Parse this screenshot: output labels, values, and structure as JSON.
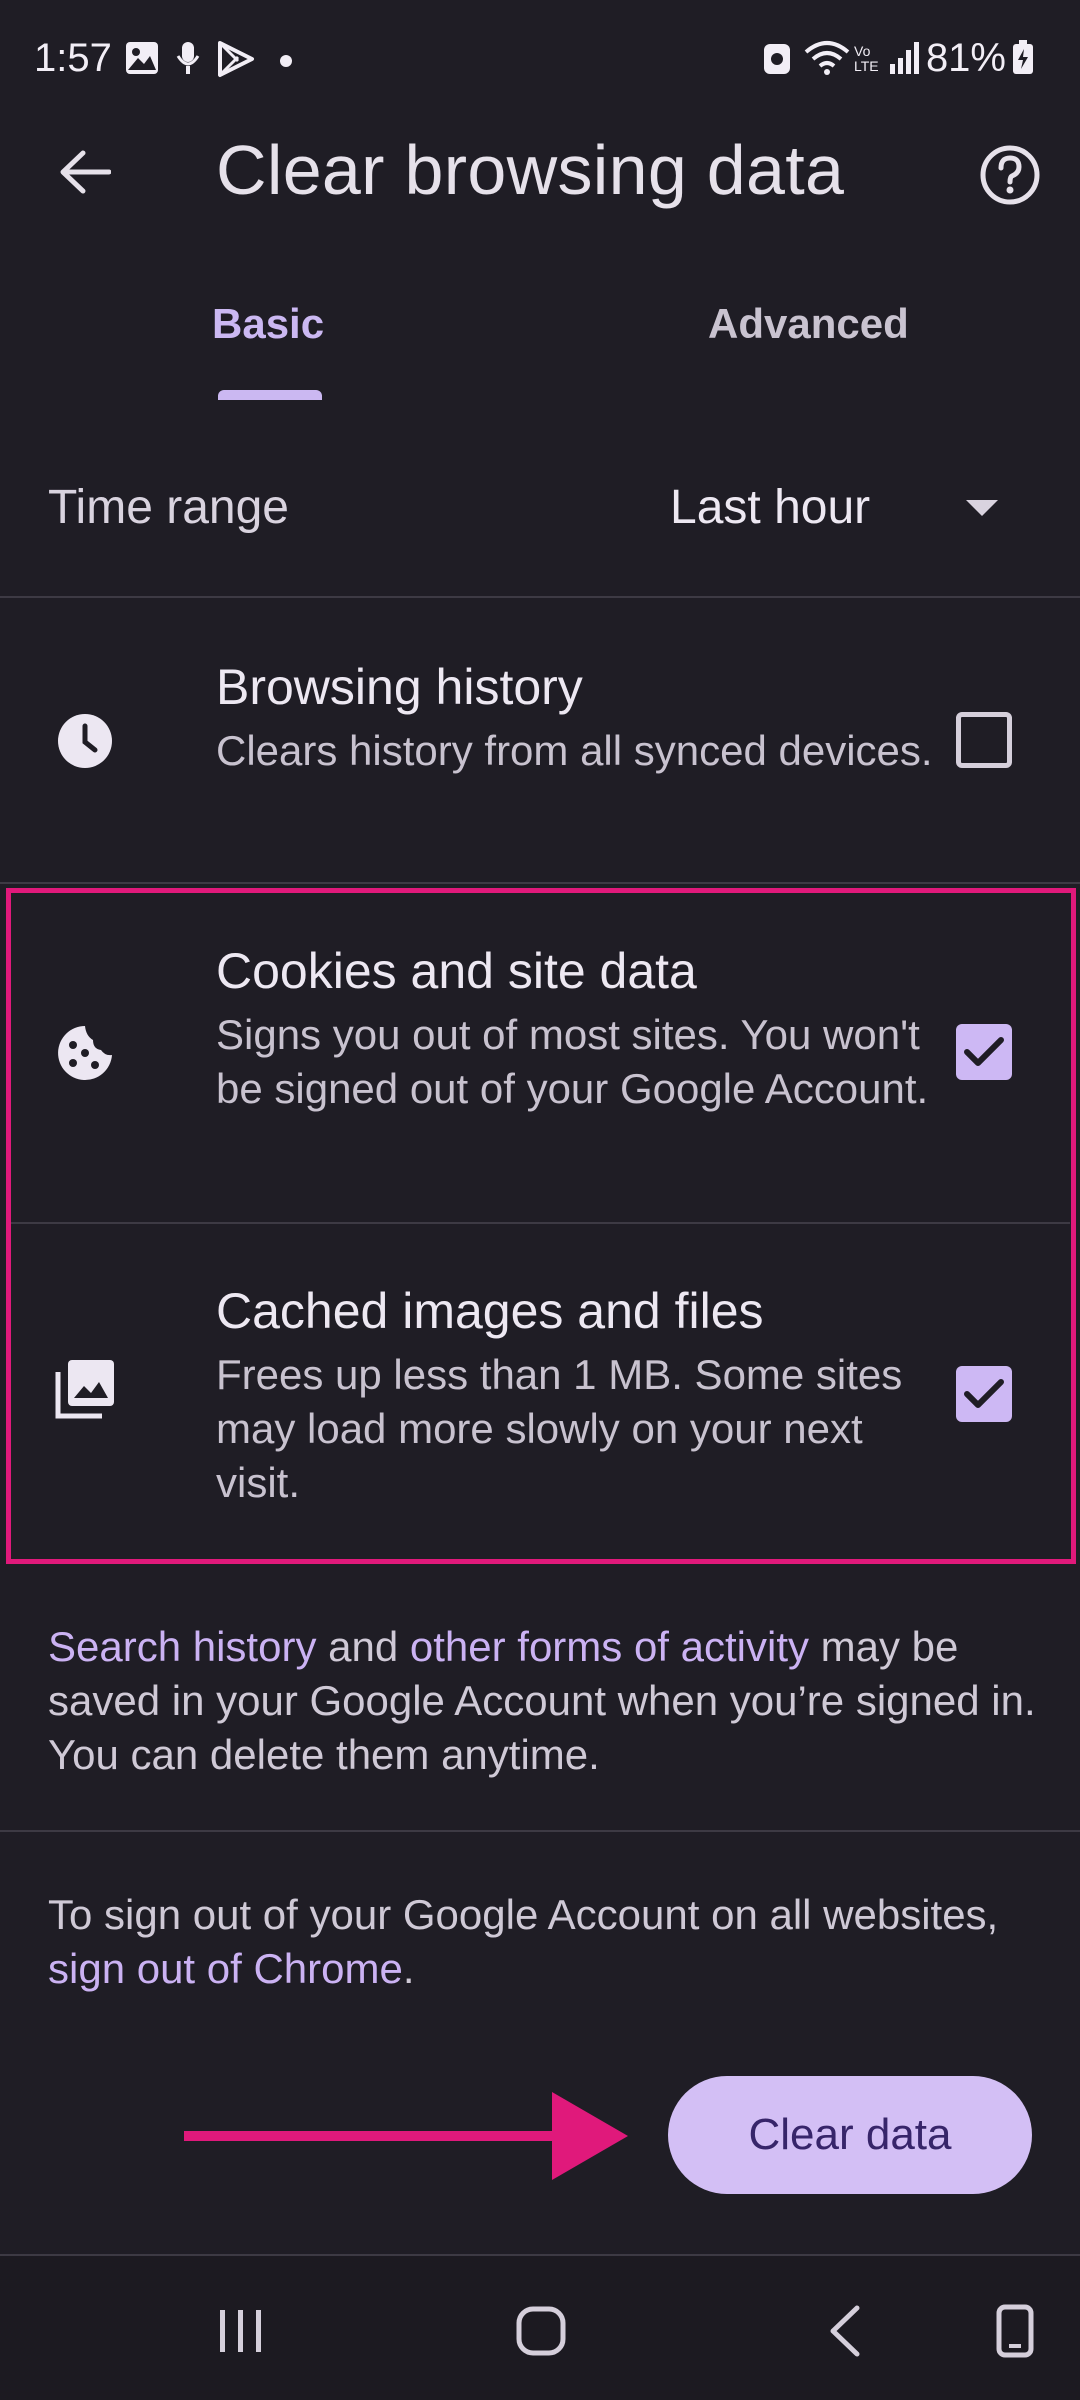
{
  "status_bar": {
    "time": "1:57",
    "battery": "81%",
    "icons": [
      "gallery-icon",
      "mic-icon",
      "play-store-icon",
      "dot-icon",
      "vpn-icon",
      "wifi-icon",
      "volte-icon",
      "signal-icon",
      "battery-icon"
    ]
  },
  "app_bar": {
    "title": "Clear browsing data",
    "back_icon": "arrow-back-icon",
    "help_icon": "help-circle-icon"
  },
  "tabs": [
    {
      "label": "Basic",
      "selected": true
    },
    {
      "label": "Advanced",
      "selected": false
    }
  ],
  "time_range": {
    "label": "Time range",
    "value": "Last hour"
  },
  "options": [
    {
      "icon": "clock-icon",
      "title": "Browsing history",
      "description": "Clears history from all synced devices.",
      "checked": false
    },
    {
      "icon": "cookie-icon",
      "title": "Cookies and site data",
      "description": "Signs you out of most sites. You won't be signed out of your Google Account.",
      "checked": true
    },
    {
      "icon": "image-stack-icon",
      "title": "Cached images and files",
      "description": "Frees up less than 1 MB. Some sites may load more slowly on your next visit.",
      "checked": true
    }
  ],
  "info1": {
    "link1": "Search history",
    "and": " and ",
    "link2": "other forms of activity",
    "rest": " may be saved in your Google Account when you’re signed in. You can delete them anytime."
  },
  "info2": {
    "text": "To sign out of your Google Account on all websites, ",
    "link": "sign out of Chrome",
    "end": "."
  },
  "clear_button": "Clear data",
  "annotation_colors": {
    "highlight": "#e0197b",
    "accent": "#cbb8f2"
  },
  "nav_bar": [
    "recents-icon",
    "home-icon",
    "back-icon",
    "keyboard-icon"
  ]
}
